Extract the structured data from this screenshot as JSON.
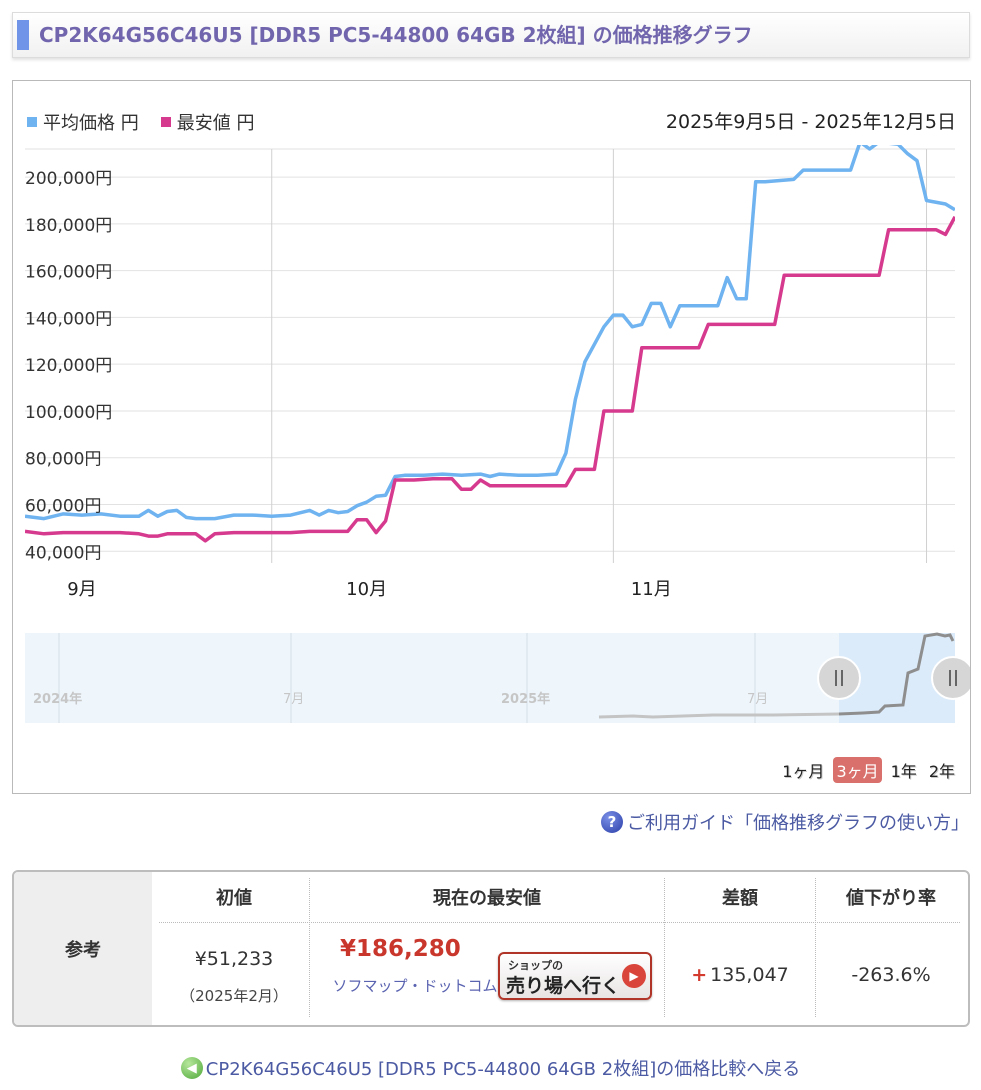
{
  "title": {
    "text": "CP2K64G56C46U5 [DDR5 PC5-44800 64GB 2枚組] の価格推移グラフ"
  },
  "legend": {
    "avg_label": "平均価格 円",
    "min_label": "最安値 円"
  },
  "date_range": "2025年9月5日 - 2025年12月5日",
  "range_buttons": [
    {
      "label": "1ヶ月",
      "active": false
    },
    {
      "label": "3ヶ月",
      "active": true
    },
    {
      "label": "1年",
      "active": false
    },
    {
      "label": "2年",
      "active": false
    }
  ],
  "colors": {
    "avg": "#6fb3f0",
    "min": "#d63a8e",
    "accent": "#7166ad",
    "price_red": "#c9372c"
  },
  "guide_link": "ご利用ガイド「価格推移グラフの使い方」",
  "reference": {
    "row_label": "参考",
    "headers": [
      "初値",
      "現在の最安値",
      "差額",
      "値下がり率"
    ],
    "initial_price": "¥51,233",
    "initial_date": "（2025年2月）",
    "lowest_price": "¥186,280",
    "shop_name": "ソフマップ・ドットコム",
    "shop_button_small": "ショップの",
    "shop_button_big": "売り場へ行く",
    "difference_sign": "+",
    "difference": "135,047",
    "drop_rate": "-263.6%"
  },
  "back_link": "CP2K64G56C46U5 [DDR5 PC5-44800 64GB 2枚組]の価格比較へ戻る",
  "chart_data": {
    "type": "line",
    "x_unit": "date (2025)",
    "xlim": [
      "2025-09-05",
      "2025-12-05"
    ],
    "ylim": [
      35000,
      210000
    ],
    "grid": true,
    "legend_position": "top-left",
    "y_ticks": [
      40000,
      60000,
      80000,
      100000,
      120000,
      140000,
      160000,
      180000,
      200000
    ],
    "y_tick_labels": [
      "40,000円",
      "60,000円",
      "80,000円",
      "100,000円",
      "120,000円",
      "140,000円",
      "160,000円",
      "180,000円",
      "200,000円"
    ],
    "x_ticks": [
      "2025-09-11",
      "2025-10-11",
      "2025-11-10"
    ],
    "x_tick_labels": [
      "9月",
      "10月",
      "11月"
    ],
    "series": [
      {
        "name": "平均価格 円",
        "points": [
          [
            "2025-09-05",
            55000
          ],
          [
            "2025-09-07",
            54000
          ],
          [
            "2025-09-09",
            56000
          ],
          [
            "2025-09-11",
            55500
          ],
          [
            "2025-09-13",
            56000
          ],
          [
            "2025-09-15",
            55000
          ],
          [
            "2025-09-17",
            55000
          ],
          [
            "2025-09-18",
            57500
          ],
          [
            "2025-09-19",
            55000
          ],
          [
            "2025-09-20",
            57000
          ],
          [
            "2025-09-21",
            57500
          ],
          [
            "2025-09-22",
            54500
          ],
          [
            "2025-09-23",
            54000
          ],
          [
            "2025-09-25",
            54000
          ],
          [
            "2025-09-27",
            55500
          ],
          [
            "2025-09-29",
            55500
          ],
          [
            "2025-10-01",
            55000
          ],
          [
            "2025-10-03",
            55500
          ],
          [
            "2025-10-05",
            57500
          ],
          [
            "2025-10-06",
            55500
          ],
          [
            "2025-10-07",
            57500
          ],
          [
            "2025-10-08",
            56500
          ],
          [
            "2025-10-09",
            57000
          ],
          [
            "2025-10-10",
            59500
          ],
          [
            "2025-10-11",
            61000
          ],
          [
            "2025-10-12",
            63500
          ],
          [
            "2025-10-13",
            64000
          ],
          [
            "2025-10-14",
            72000
          ],
          [
            "2025-10-15",
            72500
          ],
          [
            "2025-10-17",
            72500
          ],
          [
            "2025-10-19",
            73000
          ],
          [
            "2025-10-21",
            72500
          ],
          [
            "2025-10-23",
            73000
          ],
          [
            "2025-10-24",
            72000
          ],
          [
            "2025-10-25",
            73000
          ],
          [
            "2025-10-27",
            72500
          ],
          [
            "2025-10-29",
            72500
          ],
          [
            "2025-10-31",
            73000
          ],
          [
            "2025-11-01",
            82000
          ],
          [
            "2025-11-02",
            105000
          ],
          [
            "2025-11-03",
            121000
          ],
          [
            "2025-11-05",
            136000
          ],
          [
            "2025-11-06",
            141000
          ],
          [
            "2025-11-07",
            141000
          ],
          [
            "2025-11-08",
            136000
          ],
          [
            "2025-11-09",
            137000
          ],
          [
            "2025-11-10",
            146000
          ],
          [
            "2025-11-11",
            146000
          ],
          [
            "2025-11-12",
            136000
          ],
          [
            "2025-11-13",
            145000
          ],
          [
            "2025-11-14",
            145000
          ],
          [
            "2025-11-16",
            145000
          ],
          [
            "2025-11-17",
            145000
          ],
          [
            "2025-11-18",
            157000
          ],
          [
            "2025-11-19",
            148000
          ],
          [
            "2025-11-20",
            148000
          ],
          [
            "2025-11-21",
            198000
          ],
          [
            "2025-11-22",
            198000
          ],
          [
            "2025-11-25",
            199000
          ],
          [
            "2025-11-26",
            203000
          ],
          [
            "2025-11-28",
            203000
          ],
          [
            "2025-11-30",
            203000
          ],
          [
            "2025-12-01",
            203000
          ],
          [
            "2025-12-02",
            215000
          ],
          [
            "2025-12-03",
            212000
          ],
          [
            "2025-12-04",
            215000
          ],
          [
            "2025-12-05",
            214500
          ],
          [
            "2025-12-06",
            214000
          ],
          [
            "2025-12-07",
            210000
          ],
          [
            "2025-12-08",
            207000
          ],
          [
            "2025-12-09",
            190000
          ],
          [
            "2025-12-11",
            188500
          ],
          [
            "2025-12-12",
            186000
          ]
        ]
      },
      {
        "name": "最安値 円",
        "points": [
          [
            "2025-09-05",
            48500
          ],
          [
            "2025-09-07",
            47500
          ],
          [
            "2025-09-09",
            48000
          ],
          [
            "2025-09-15",
            48000
          ],
          [
            "2025-09-17",
            47500
          ],
          [
            "2025-09-18",
            46500
          ],
          [
            "2025-09-19",
            46500
          ],
          [
            "2025-09-20",
            47500
          ],
          [
            "2025-09-22",
            47500
          ],
          [
            "2025-09-23",
            47500
          ],
          [
            "2025-09-24",
            44500
          ],
          [
            "2025-09-25",
            47500
          ],
          [
            "2025-09-27",
            48000
          ],
          [
            "2025-10-01",
            48000
          ],
          [
            "2025-10-03",
            48000
          ],
          [
            "2025-10-05",
            48500
          ],
          [
            "2025-10-07",
            48500
          ],
          [
            "2025-10-09",
            48500
          ],
          [
            "2025-10-10",
            53500
          ],
          [
            "2025-10-11",
            53500
          ],
          [
            "2025-10-12",
            48000
          ],
          [
            "2025-10-13",
            53000
          ],
          [
            "2025-10-14",
            70500
          ],
          [
            "2025-10-16",
            70500
          ],
          [
            "2025-10-18",
            71000
          ],
          [
            "2025-10-20",
            71000
          ],
          [
            "2025-10-21",
            66500
          ],
          [
            "2025-10-22",
            66500
          ],
          [
            "2025-10-23",
            70500
          ],
          [
            "2025-10-24",
            68000
          ],
          [
            "2025-10-26",
            68000
          ],
          [
            "2025-10-28",
            68000
          ],
          [
            "2025-10-30",
            68000
          ],
          [
            "2025-11-01",
            68000
          ],
          [
            "2025-11-02",
            75000
          ],
          [
            "2025-11-04",
            75000
          ],
          [
            "2025-11-05",
            100000
          ],
          [
            "2025-11-08",
            100000
          ],
          [
            "2025-11-09",
            127000
          ],
          [
            "2025-11-15",
            127000
          ],
          [
            "2025-11-16",
            137000
          ],
          [
            "2025-11-23",
            137000
          ],
          [
            "2025-11-24",
            158000
          ],
          [
            "2025-12-04",
            158000
          ],
          [
            "2025-12-05",
            177500
          ],
          [
            "2025-12-09",
            177500
          ],
          [
            "2025-12-10",
            177500
          ],
          [
            "2025-12-11",
            175500
          ],
          [
            "2025-12-12",
            183000
          ]
        ]
      }
    ],
    "navigator": {
      "tick_labels": [
        "2024年",
        "7月",
        "2025年",
        "7月"
      ],
      "series_start": "2025-02"
    }
  }
}
